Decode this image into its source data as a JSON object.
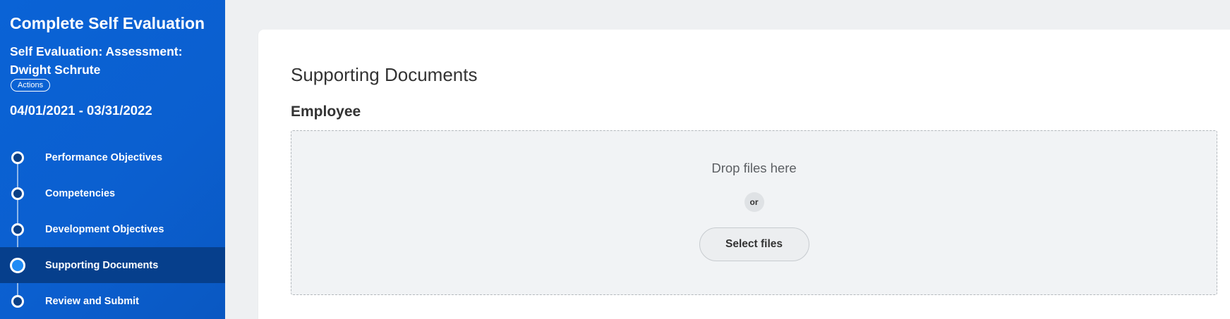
{
  "sidebar": {
    "title": "Complete Self Evaluation",
    "subtitle": "Self Evaluation: Assessment: Dwight Schrute",
    "actions_label": "Actions",
    "date_range": "04/01/2021 - 03/31/2022",
    "steps": [
      {
        "label": "Performance Objectives",
        "active": false
      },
      {
        "label": "Competencies",
        "active": false
      },
      {
        "label": "Development Objectives",
        "active": false
      },
      {
        "label": "Supporting Documents",
        "active": true
      },
      {
        "label": "Review and Submit",
        "active": false
      }
    ]
  },
  "main": {
    "section_title": "Supporting Documents",
    "subsection_title": "Employee",
    "dropzone": {
      "drop_text": "Drop files here",
      "or_text": "or",
      "select_button_label": "Select files"
    }
  },
  "colors": {
    "sidebar_bg": "#0a63d6",
    "active_step_bg": "#063f8c",
    "active_dot": "#1f8bf5",
    "page_bg": "#eef0f2",
    "dropzone_bg": "#f1f3f5"
  }
}
